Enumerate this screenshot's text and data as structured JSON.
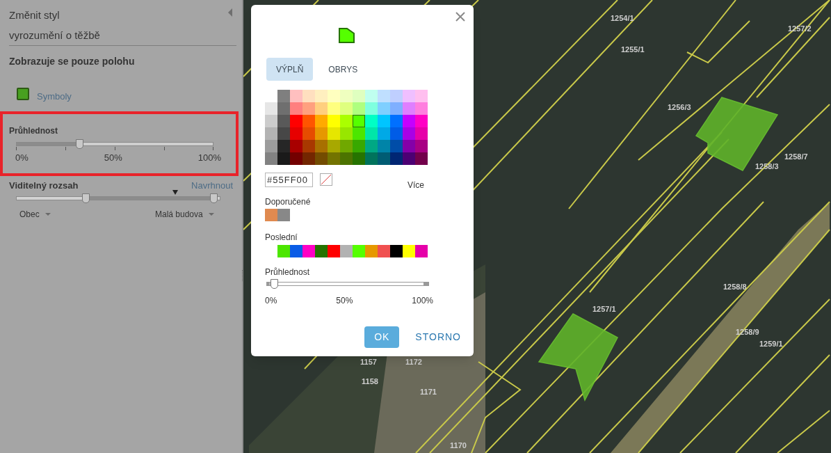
{
  "sidebar": {
    "title": "Změnit styl",
    "layer_name": "vyrozumění o těžbě",
    "mode_heading": "Zobrazuje se pouze polohu",
    "symbols_link": {
      "label": "Symboly",
      "color": "#48a020"
    },
    "transparency": {
      "label": "Průhlednost",
      "level": 0.32,
      "ticks": [
        "0%",
        "50%",
        "100%"
      ]
    },
    "visible_range": {
      "label": "Viditelný rozsah",
      "suggest_link": "Navrhnout",
      "thumbs": [
        {
          "level": 0.34
        },
        {
          "level": 0.97
        }
      ],
      "current_marker": {
        "level": 0.78
      },
      "dropdowns": [
        {
          "value": "Obec"
        },
        {
          "value": "Malá budova"
        }
      ]
    }
  },
  "dialog": {
    "tabs": [
      {
        "label": "VÝPLŇ",
        "selected": true
      },
      {
        "label": "OBRYS",
        "selected": false
      }
    ],
    "palette": [
      [
        {
          "color": "#7f7f7f",
          "selected": false
        },
        {
          "color": "#ffbfbf",
          "selected": false
        },
        {
          "color": "#ffdfbf",
          "selected": false
        },
        {
          "color": "#ffefbf",
          "selected": false
        },
        {
          "color": "#ffffbf",
          "selected": false
        },
        {
          "color": "#efffbf",
          "selected": false
        },
        {
          "color": "#dfffbf",
          "selected": false
        },
        {
          "color": "#bfffef",
          "selected": false
        },
        {
          "color": "#bfdfff",
          "selected": false
        },
        {
          "color": "#bfcfff",
          "selected": false
        },
        {
          "color": "#efbfff",
          "selected": false
        },
        {
          "color": "#ffbfef",
          "selected": false
        }
      ],
      [
        {
          "color": "#e6e6e6",
          "selected": false
        },
        {
          "color": "#6f6f6f",
          "selected": false
        },
        {
          "color": "#ff7f7f",
          "selected": false
        },
        {
          "color": "#ffa07f",
          "selected": false
        },
        {
          "color": "#ffcf7f",
          "selected": false
        },
        {
          "color": "#ffff7f",
          "selected": false
        },
        {
          "color": "#dfff7f",
          "selected": false
        },
        {
          "color": "#afff7f",
          "selected": false
        },
        {
          "color": "#7fffdf",
          "selected": false
        },
        {
          "color": "#7fcfff",
          "selected": false
        },
        {
          "color": "#7fafff",
          "selected": false
        },
        {
          "color": "#df7fff",
          "selected": false
        },
        {
          "color": "#ff7fdf",
          "selected": false
        }
      ],
      [
        {
          "color": "#cccccc",
          "selected": false
        },
        {
          "color": "#595959",
          "selected": false
        },
        {
          "color": "#ff0000",
          "selected": false
        },
        {
          "color": "#ff5500",
          "selected": false
        },
        {
          "color": "#ffaa00",
          "selected": false
        },
        {
          "color": "#ffff00",
          "selected": false
        },
        {
          "color": "#aaff00",
          "selected": false
        },
        {
          "color": "#55ff00",
          "selected": true
        },
        {
          "color": "#00ffc5",
          "selected": false
        },
        {
          "color": "#00c5ff",
          "selected": false
        },
        {
          "color": "#0070ff",
          "selected": false
        },
        {
          "color": "#c500ff",
          "selected": false
        },
        {
          "color": "#ff00c5",
          "selected": false
        }
      ],
      [
        {
          "color": "#b3b3b3",
          "selected": false
        },
        {
          "color": "#474747",
          "selected": false
        },
        {
          "color": "#e60000",
          "selected": false
        },
        {
          "color": "#e64c00",
          "selected": false
        },
        {
          "color": "#e69800",
          "selected": false
        },
        {
          "color": "#e6e600",
          "selected": false
        },
        {
          "color": "#98e600",
          "selected": false
        },
        {
          "color": "#4ce600",
          "selected": false
        },
        {
          "color": "#00e6a9",
          "selected": false
        },
        {
          "color": "#00a9e6",
          "selected": false
        },
        {
          "color": "#005ce6",
          "selected": false
        },
        {
          "color": "#a900e6",
          "selected": false
        },
        {
          "color": "#e600a9",
          "selected": false
        }
      ],
      [
        {
          "color": "#9c9c9c",
          "selected": false
        },
        {
          "color": "#262626",
          "selected": false
        },
        {
          "color": "#a80000",
          "selected": false
        },
        {
          "color": "#a83800",
          "selected": false
        },
        {
          "color": "#a87000",
          "selected": false
        },
        {
          "color": "#a8a800",
          "selected": false
        },
        {
          "color": "#70a800",
          "selected": false
        },
        {
          "color": "#38a800",
          "selected": false
        },
        {
          "color": "#00a884",
          "selected": false
        },
        {
          "color": "#0084a8",
          "selected": false
        },
        {
          "color": "#004da8",
          "selected": false
        },
        {
          "color": "#8400a8",
          "selected": false
        },
        {
          "color": "#a80084",
          "selected": false
        }
      ],
      [
        {
          "color": "#828282",
          "selected": false
        },
        {
          "color": "#1a1a1a",
          "selected": false
        },
        {
          "color": "#730000",
          "selected": false
        },
        {
          "color": "#732600",
          "selected": false
        },
        {
          "color": "#734c00",
          "selected": false
        },
        {
          "color": "#737300",
          "selected": false
        },
        {
          "color": "#4c7300",
          "selected": false
        },
        {
          "color": "#267300",
          "selected": false
        },
        {
          "color": "#00735c",
          "selected": false
        },
        {
          "color": "#005c73",
          "selected": false
        },
        {
          "color": "#002673",
          "selected": false
        },
        {
          "color": "#4c0073",
          "selected": false
        },
        {
          "color": "#73004c",
          "selected": false
        }
      ]
    ],
    "hex_value": "#55FF00",
    "more_link": "Více",
    "recommended": {
      "label": "Doporučené",
      "swatches": [
        {
          "color": "#e08a50"
        },
        {
          "color": "#888888"
        }
      ]
    },
    "recent": {
      "label": "Poslední",
      "swatches": [
        {
          "color": "#4ce600"
        },
        {
          "color": "#0a5ce6"
        },
        {
          "color": "#ff00c5"
        },
        {
          "color": "#267300"
        },
        {
          "color": "#ff0000"
        },
        {
          "color": "#b2b2b2"
        },
        {
          "color": "#55ff00"
        },
        {
          "color": "#e69800"
        },
        {
          "color": "#f05050"
        },
        {
          "color": "#000000"
        },
        {
          "color": "#ffff00"
        },
        {
          "color": "#e600a9"
        }
      ]
    },
    "transparency": {
      "label": "Průhlednost",
      "level": 0.03,
      "ticks": [
        "0%",
        "50%",
        "100%"
      ]
    },
    "buttons": [
      {
        "label": "OK",
        "kind": "primary"
      },
      {
        "label": "STORNO",
        "kind": "secondary"
      }
    ]
  },
  "map": {
    "parcel_labels": [
      "1254/1",
      "1255/1",
      "1257/2",
      "1256/3",
      "1258/3",
      "1258/7",
      "1257/1",
      "1258/8",
      "1258/9",
      "1259/1",
      "1157",
      "1172",
      "1158",
      "1171",
      "1170"
    ]
  }
}
